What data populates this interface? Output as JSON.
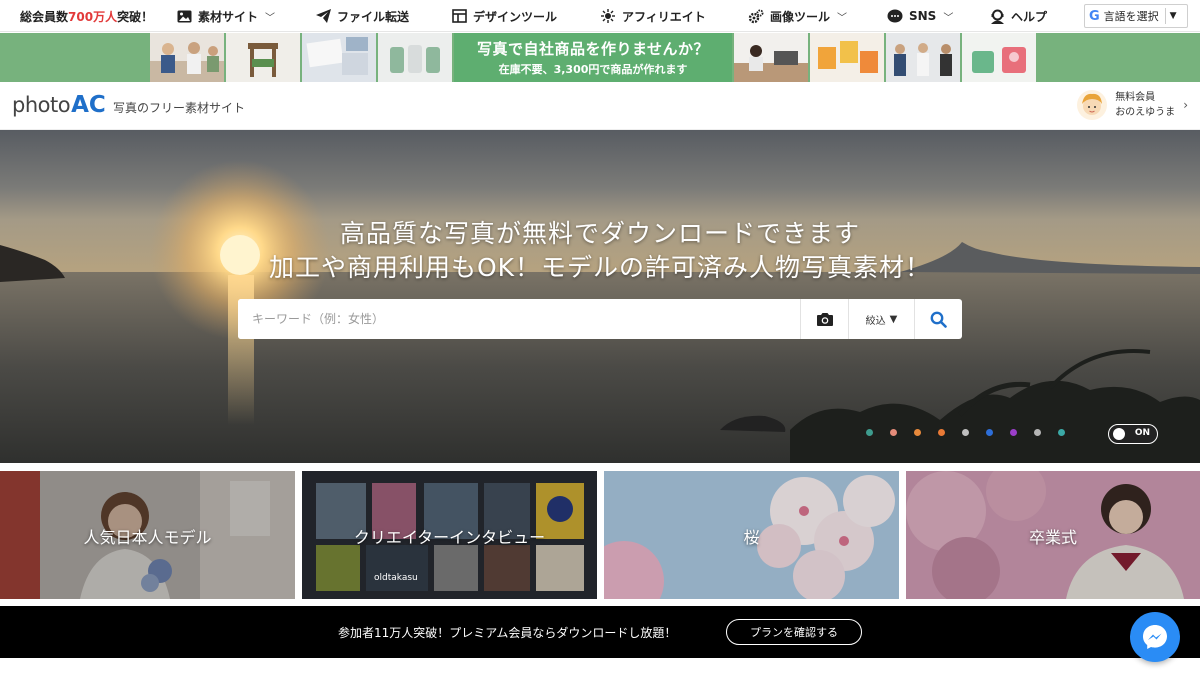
{
  "topnav": {
    "members_prefix": "総会員数",
    "members_count": "700万人",
    "members_suffix": "突破！",
    "items": [
      {
        "label": "素材サイト",
        "icon": "photo-icon",
        "has_dropdown": true
      },
      {
        "label": "ファイル転送",
        "icon": "paper-plane-icon",
        "has_dropdown": false
      },
      {
        "label": "デザインツール",
        "icon": "layout-icon",
        "has_dropdown": false
      },
      {
        "label": "アフィリエイト",
        "icon": "network-icon",
        "has_dropdown": false
      },
      {
        "label": "画像ツール",
        "icon": "gears-icon",
        "has_dropdown": true
      },
      {
        "label": "SNS",
        "icon": "chat-icon",
        "has_dropdown": true
      },
      {
        "label": "ヘルプ",
        "icon": "support-icon",
        "has_dropdown": false
      }
    ],
    "language_select": "言語を選択"
  },
  "banner": {
    "title": "写真で自社商品を作りませんか？",
    "subtitle": "在庫不要、3,300円で商品が作れます"
  },
  "header": {
    "logo_photo": "photo",
    "logo_ac": "AC",
    "tagline": "写真のフリー素材サイト",
    "user_status": "無料会員",
    "user_name": "おのえゆうま"
  },
  "hero": {
    "headline1": "高品質な写真が無料でダウンロードできます",
    "headline2": "加工や商用利用もOK！モデルの許可済み人物写真素材！",
    "search_placeholder": "キーワード（例：女性）",
    "filter_label": "絞込",
    "toggle_label": "ON",
    "slide_dots": [
      "#3e9c8e",
      "#e58c7a",
      "#e88a3c",
      "#e97a36",
      "#bfbfbf",
      "#2d6ed8",
      "#9b3ec9",
      "#b5b5b5",
      "#3ba9a6"
    ]
  },
  "categories": [
    {
      "label": "人気日本人モデル"
    },
    {
      "label": "クリエイターインタビュー"
    },
    {
      "label": "桜"
    },
    {
      "label": "卒業式"
    }
  ],
  "creator_tag": "oldtakasu",
  "premium_bar": {
    "text": "参加者11万人突破！プレミアム会員ならダウンロードし放題！",
    "button": "プランを確認する"
  },
  "colors": {
    "brand_blue": "#1f6fc9",
    "banner_green": "#5eae70",
    "alert_red": "#e23a3a",
    "messenger_blue": "#2a8cf5"
  }
}
